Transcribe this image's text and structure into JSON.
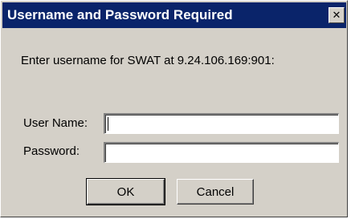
{
  "dialog": {
    "title": "Username and Password Required",
    "close_glyph": "✕",
    "prompt": "Enter username for SWAT at 9.24.106.169:901:",
    "username": {
      "label": "User Name:",
      "value": ""
    },
    "password": {
      "label": "Password:",
      "value": ""
    },
    "buttons": {
      "ok": "OK",
      "cancel": "Cancel"
    }
  },
  "colors": {
    "titlebar": "#0a246a",
    "face": "#d4d0c8"
  }
}
